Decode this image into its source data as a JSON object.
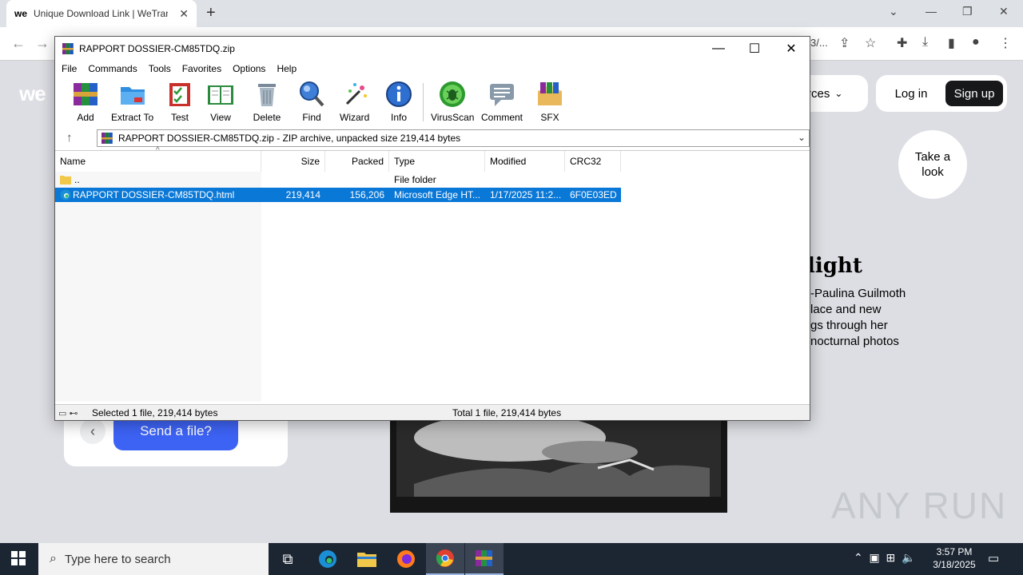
{
  "browser": {
    "tab_title": "Unique Download Link | WeTransfer",
    "tab_favicon": "we",
    "url_suffix": "3/..."
  },
  "page": {
    "logo": "we",
    "nav_resources": "rces",
    "login": "Log in",
    "signup": "Sign up",
    "take_look": "Take a look",
    "spotlight_heading": "light",
    "spotlight_lines": [
      "-Paulina Guilmoth",
      "lace and new",
      "gs through her",
      "nocturnal photos"
    ],
    "send_button": "Send a file?",
    "watermark": "ANY RUN"
  },
  "winrar": {
    "title": "RAPPORT DOSSIER-CM85TDQ.zip",
    "menu": [
      "File",
      "Commands",
      "Tools",
      "Favorites",
      "Options",
      "Help"
    ],
    "toolbar": [
      {
        "label": "Add",
        "icon": "add-archive-icon"
      },
      {
        "label": "Extract To",
        "icon": "extract-folder-icon"
      },
      {
        "label": "Test",
        "icon": "test-clipboard-icon"
      },
      {
        "label": "View",
        "icon": "view-book-icon"
      },
      {
        "label": "Delete",
        "icon": "trash-icon"
      },
      {
        "label": "Find",
        "icon": "magnifier-icon"
      },
      {
        "label": "Wizard",
        "icon": "wand-icon"
      },
      {
        "label": "Info",
        "icon": "info-icon"
      },
      {
        "label": "VirusScan",
        "icon": "bug-scan-icon"
      },
      {
        "label": "Comment",
        "icon": "comment-icon"
      },
      {
        "label": "SFX",
        "icon": "sfx-box-icon"
      }
    ],
    "address": "RAPPORT DOSSIER-CM85TDQ.zip - ZIP archive, unpacked size 219,414 bytes",
    "columns": [
      "Name",
      "Size",
      "Packed",
      "Type",
      "Modified",
      "CRC32"
    ],
    "rows": [
      {
        "name": "..",
        "size": "",
        "packed": "",
        "type": "File folder",
        "modified": "",
        "crc": "",
        "icon": "folder-icon",
        "selected": false
      },
      {
        "name": "RAPPORT DOSSIER-CM85TDQ.html",
        "size": "219,414",
        "packed": "156,206",
        "type": "Microsoft Edge HT...",
        "modified": "1/17/2025 11:2...",
        "crc": "6F0E03ED",
        "icon": "edge-icon",
        "selected": true
      }
    ],
    "status_left": "Selected 1 file, 219,414 bytes",
    "status_right": "Total 1 file, 219,414 bytes"
  },
  "taskbar": {
    "search_placeholder": "Type here to search",
    "time": "3:57 PM",
    "date": "3/18/2025"
  }
}
